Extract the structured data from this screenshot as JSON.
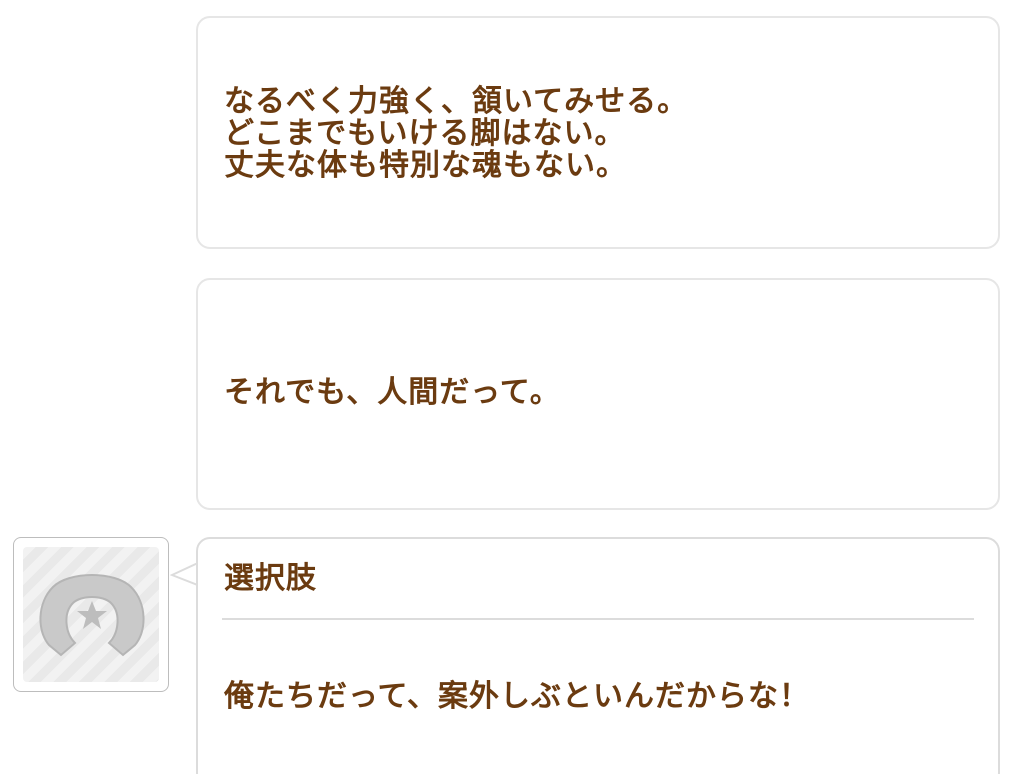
{
  "dialogue": {
    "bubble1_lines": [
      "なるべく力強く、頷いてみせる。",
      "どこまでもいける脚はない。",
      "丈夫な体も特別な魂もない。"
    ],
    "bubble2_text": "それでも、人間だって。"
  },
  "choice": {
    "header": "選択肢",
    "option_text": "俺たちだって、案外しぶといんだからな！"
  },
  "colors": {
    "text": "#6b3b10",
    "bubble_border": "#e6e6e6"
  },
  "icons": {
    "avatar": "horseshoe-star-icon"
  }
}
